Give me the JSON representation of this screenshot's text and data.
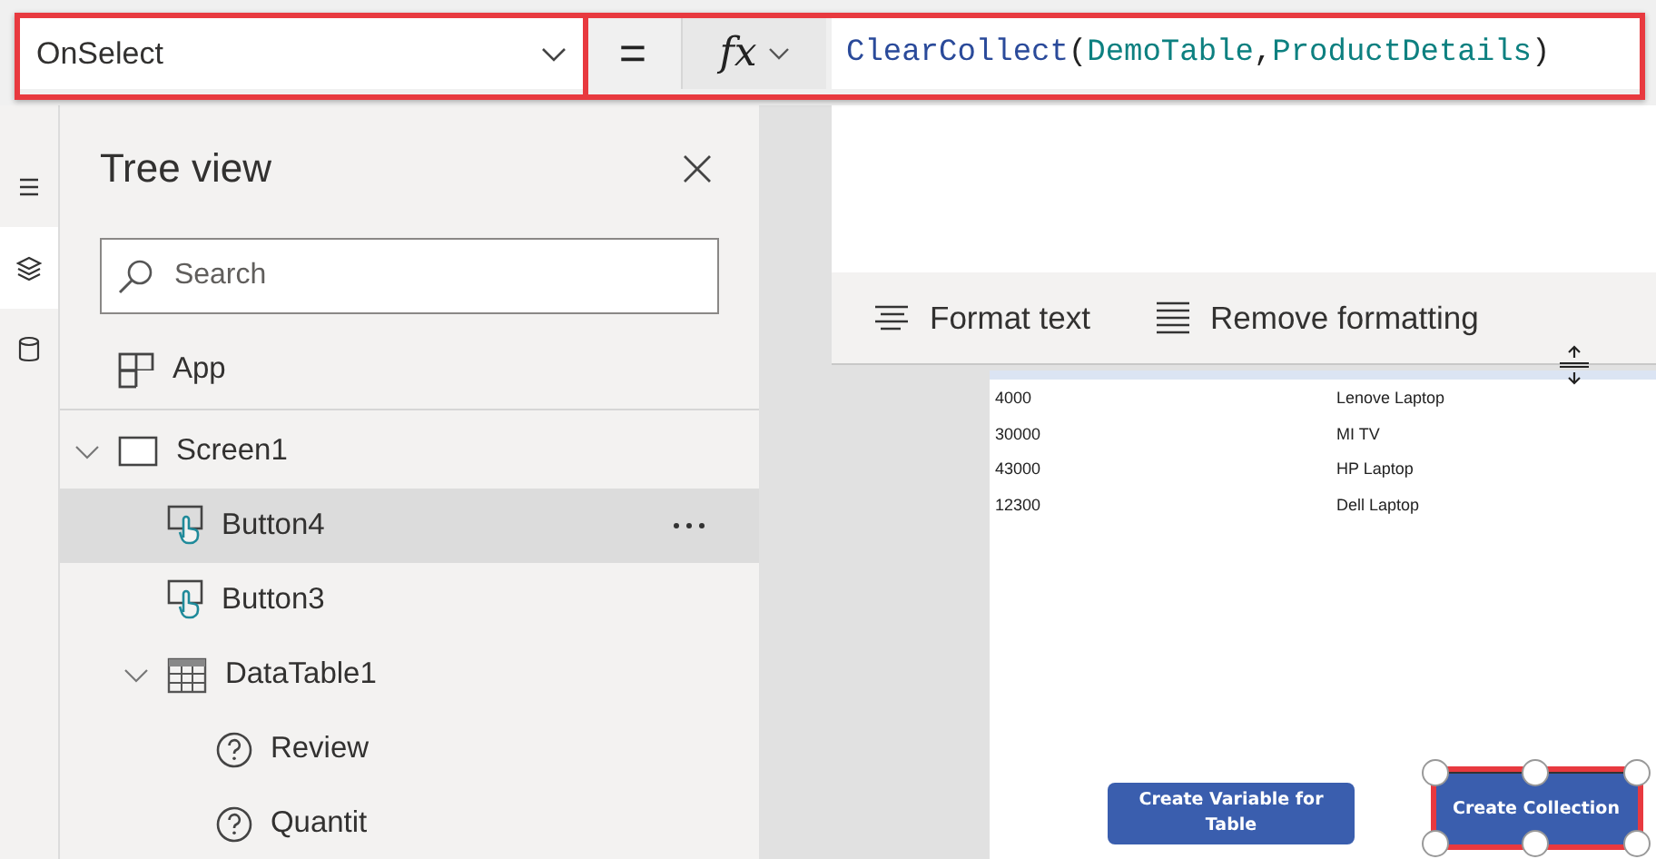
{
  "formula_bar": {
    "property": "OnSelect",
    "equals": "=",
    "fx": "fx",
    "highlighted": true,
    "formula": [
      {
        "kind": "function",
        "text": "ClearCollect"
      },
      {
        "kind": "punctuation",
        "text": "("
      },
      {
        "kind": "identifier",
        "text": "DemoTable"
      },
      {
        "kind": "punctuation",
        "text": ","
      },
      {
        "kind": "identifier",
        "text": "ProductDetails"
      },
      {
        "kind": "punctuation",
        "text": ")"
      }
    ]
  },
  "rail": [
    {
      "kind": "menu",
      "selected": false
    },
    {
      "kind": "layers",
      "selected": true
    },
    {
      "kind": "data",
      "selected": false
    }
  ],
  "tree_view": {
    "title": "Tree view",
    "search": {
      "placeholder": "Search"
    },
    "items": [
      {
        "label": "App",
        "kind": "app",
        "selected": false
      },
      {
        "label": "Screen1",
        "kind": "screen",
        "selected": false,
        "expanded": true,
        "children": [
          {
            "label": "Button4",
            "kind": "button",
            "selected": true
          },
          {
            "label": "Button3",
            "kind": "button",
            "selected": false
          },
          {
            "label": "DataTable1",
            "kind": "table",
            "selected": false,
            "expanded": true,
            "children": [
              {
                "label": "Review",
                "kind": "field",
                "selected": false
              },
              {
                "label": "Quantit",
                "kind": "field",
                "selected": false
              }
            ]
          }
        ]
      }
    ]
  },
  "toolbar": [
    {
      "kind": "format",
      "label": "Format text"
    },
    {
      "kind": "remove",
      "label": "Remove formatting"
    }
  ],
  "canvas": {
    "table": {
      "rows": [
        [
          "4000",
          "Lenove Laptop"
        ],
        [
          "30000",
          "MI TV"
        ],
        [
          "43000",
          "HP Laptop"
        ],
        [
          "12300",
          "Dell Laptop"
        ]
      ]
    },
    "buttons": [
      {
        "label": "Create Variable for Table",
        "selected": false
      },
      {
        "label": "Create Collection",
        "selected": true
      }
    ]
  }
}
